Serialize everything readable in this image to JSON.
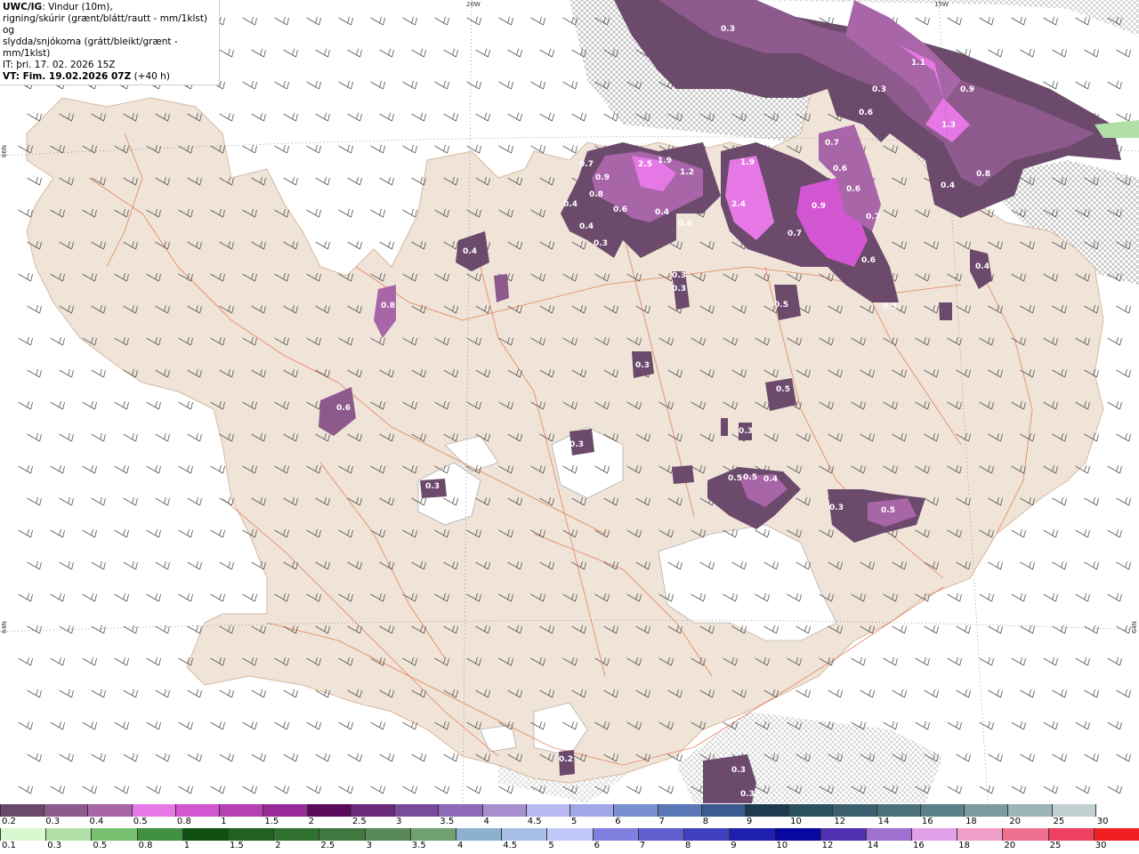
{
  "title": {
    "model": "UWC/IG",
    "line1_rest": ": Vindur (10m),",
    "line2": "rigning/skúrir (grænt/blátt/rautt - mm/1klst) og",
    "line3": "slydda/snjókoma (grátt/bleikt/grænt - mm/1klst)",
    "it": "IT: þri. 17. 02. 2026 15Z",
    "vt": "VT: Fim. 19.02.2026 07Z",
    "lead": "(+40 h)"
  },
  "graticule": {
    "lon_top": [
      "20W",
      "15W"
    ],
    "lat_left": [
      "66N",
      "64N"
    ],
    "lat_right": [
      "64N"
    ]
  },
  "precip_values": [
    {
      "v": "0.5"
    },
    {
      "v": "0.3"
    },
    {
      "v": "1.1"
    },
    {
      "v": "0.9"
    },
    {
      "v": "1.3"
    },
    {
      "v": "0.3"
    },
    {
      "v": "0.6"
    },
    {
      "v": "0.7"
    },
    {
      "v": "0.9"
    },
    {
      "v": "2.5"
    },
    {
      "v": "1.9"
    },
    {
      "v": "1.2"
    },
    {
      "v": "1.9"
    },
    {
      "v": "2.4"
    },
    {
      "v": "0.8"
    },
    {
      "v": "0.6"
    },
    {
      "v": "0.4"
    },
    {
      "v": "0.4"
    },
    {
      "v": "0.6"
    },
    {
      "v": "0.3"
    },
    {
      "v": "0.7"
    },
    {
      "v": "0.6"
    },
    {
      "v": "0.9"
    },
    {
      "v": "0.6"
    },
    {
      "v": "0.7"
    },
    {
      "v": "0.7"
    },
    {
      "v": "0.6"
    },
    {
      "v": "0.4"
    },
    {
      "v": "0.8"
    },
    {
      "v": "0.4"
    },
    {
      "v": "0.4"
    },
    {
      "v": "0.4"
    },
    {
      "v": "0.8"
    },
    {
      "v": "0.3"
    },
    {
      "v": "0.3"
    },
    {
      "v": "0.5"
    },
    {
      "v": "0.3"
    },
    {
      "v": "0.5"
    },
    {
      "v": "0.6"
    },
    {
      "v": "0.3"
    },
    {
      "v": "0.3"
    },
    {
      "v": "0.3"
    },
    {
      "v": "0.5"
    },
    {
      "v": "0.5"
    },
    {
      "v": "0.4"
    },
    {
      "v": "0.3"
    },
    {
      "v": "0.5"
    },
    {
      "v": "0.3"
    },
    {
      "v": "0.2"
    },
    {
      "v": "0.3"
    },
    {
      "v": "0.3"
    }
  ],
  "legend": {
    "snow_scale": {
      "labels": [
        "0.2",
        "0.3",
        "0.4",
        "0.5",
        "0.8",
        "1",
        "1.5",
        "2",
        "2.5",
        "3",
        "3.5",
        "4",
        "4.5",
        "5",
        "6",
        "7",
        "8",
        "9",
        "10",
        "12",
        "14",
        "16",
        "18",
        "20",
        "25",
        "30"
      ],
      "colors": [
        "#6b4a6b",
        "#8e5a8e",
        "#a865a8",
        "#e678e6",
        "#d255d2",
        "#b440b4",
        "#9a2a9a",
        "#5a0a5a",
        "#6a2a7a",
        "#7a4a9a",
        "#8e6ab8",
        "#a890d0",
        "#b8b8f0",
        "#a0a8e8",
        "#7890d0",
        "#5a78b8",
        "#3a5a90",
        "#1e3a50",
        "#2a5060",
        "#3a6070",
        "#4a7078",
        "#5a8088",
        "#7a9aa0",
        "#9ab4b8",
        "#c0d0d0",
        "#ffffff"
      ]
    },
    "rain_scale": {
      "labels": [
        "0.1",
        "0.3",
        "0.5",
        "0.8",
        "1",
        "1.5",
        "2",
        "2.5",
        "3",
        "3.5",
        "4",
        "4.5",
        "5",
        "6",
        "7",
        "8",
        "9",
        "10",
        "12",
        "14",
        "16",
        "18",
        "20",
        "25",
        "30"
      ],
      "colors": [
        "#d8f8d0",
        "#b0e0a8",
        "#78c070",
        "#409040",
        "#105010",
        "#206020",
        "#307030",
        "#407840",
        "#588858",
        "#70a070",
        "#8cb0d0",
        "#a8c0e8",
        "#c0c8f8",
        "#8080e0",
        "#6060d0",
        "#4040c0",
        "#2020b0",
        "#0808a0",
        "#5030b0",
        "#a070d0",
        "#e0a0e8",
        "#f0a0c8",
        "#f07090",
        "#f04060",
        "#f02020"
      ]
    }
  }
}
